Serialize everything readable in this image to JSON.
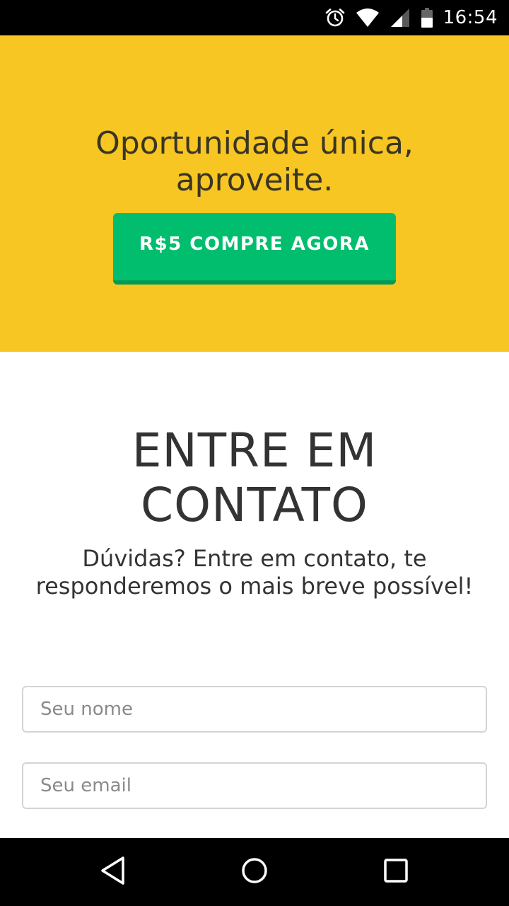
{
  "status_bar": {
    "time": "16:54",
    "icons": [
      "alarm-icon",
      "wifi-icon",
      "signal-icon",
      "battery-icon"
    ]
  },
  "promo": {
    "title": "Oportunidade única, aproveite.",
    "button_label": "R$5 COMPRE AGORA",
    "background_color": "#f7c623",
    "button_color": "#00be6e"
  },
  "contact": {
    "title": "ENTRE EM CONTATO",
    "subtitle": "Dúvidas? Entre em contato, te responderemos o mais breve possível!",
    "name_field": {
      "value": "",
      "placeholder": "Seu nome"
    },
    "email_field": {
      "value": "",
      "placeholder": "Seu email"
    }
  },
  "nav_bar": {
    "icons": [
      "back-icon",
      "home-icon",
      "recent-apps-icon"
    ]
  }
}
